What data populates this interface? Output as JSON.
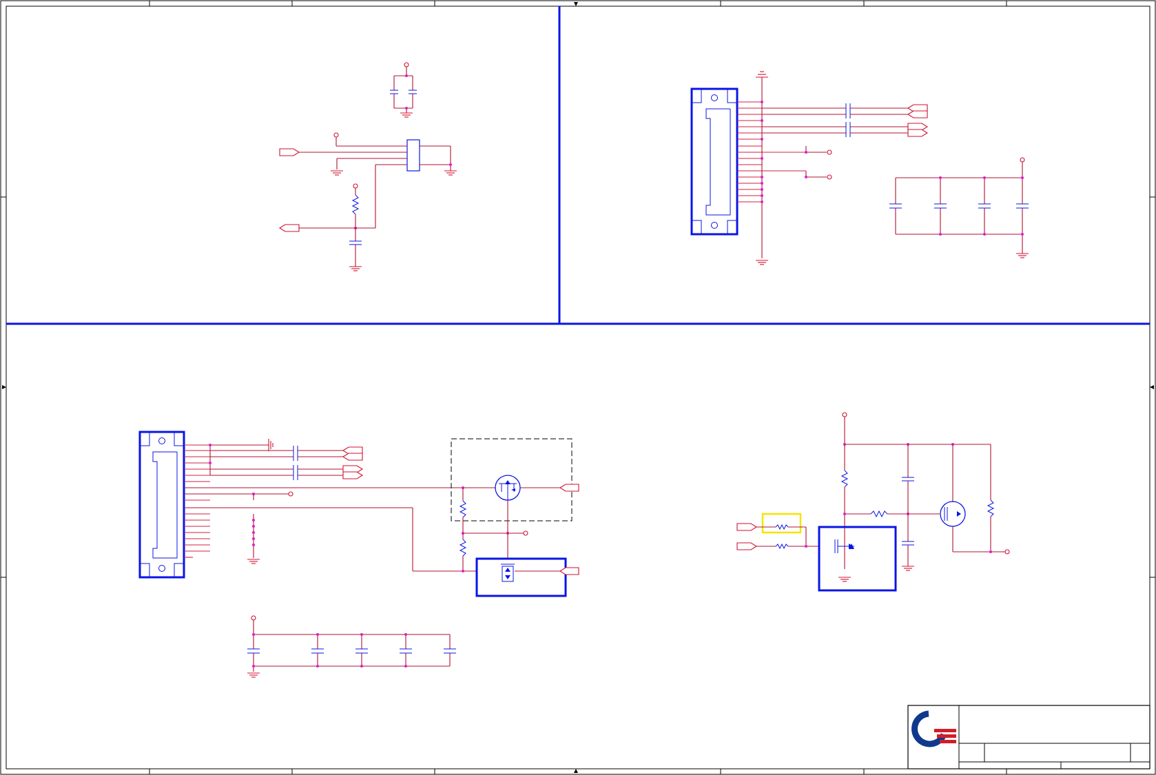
{
  "document": {
    "type": "schematic-sheet",
    "page_text": []
  },
  "colors": {
    "background": "#ffffff",
    "wire": "#b01030",
    "pin": "#d02040",
    "component_body": "#0a14e6",
    "junction": "#e01ec8",
    "highlight_box": "#f5e400",
    "logo_blue": "#0f3a8c",
    "logo_red": "#d01e28"
  },
  "sections": [
    {
      "name": "top-left-block",
      "components": [
        "bypass-capacitor-pair",
        "ic-package",
        "pullup-resistor",
        "filter-capacitor",
        "input-port",
        "output-port"
      ]
    },
    {
      "name": "top-right-block",
      "components": [
        "connector-large",
        "ac-coupling-capacitors",
        "differential-ports",
        "decoupling-capacitor-bank"
      ]
    },
    {
      "name": "bottom-left-block",
      "components": [
        "connector-large",
        "ac-coupling-capacitors",
        "differential-ports",
        "mosfet-switch-dashed-region",
        "load-switch-ic",
        "decoupling-capacitor-bank"
      ]
    },
    {
      "name": "bottom-right-block",
      "components": [
        "input-ports",
        "series-resistors-highlighted",
        "driver-ic",
        "p-mosfet",
        "pullup-resistors",
        "capacitors"
      ]
    }
  ],
  "title_block": {
    "logo": "company-logo-icon",
    "fields": []
  }
}
